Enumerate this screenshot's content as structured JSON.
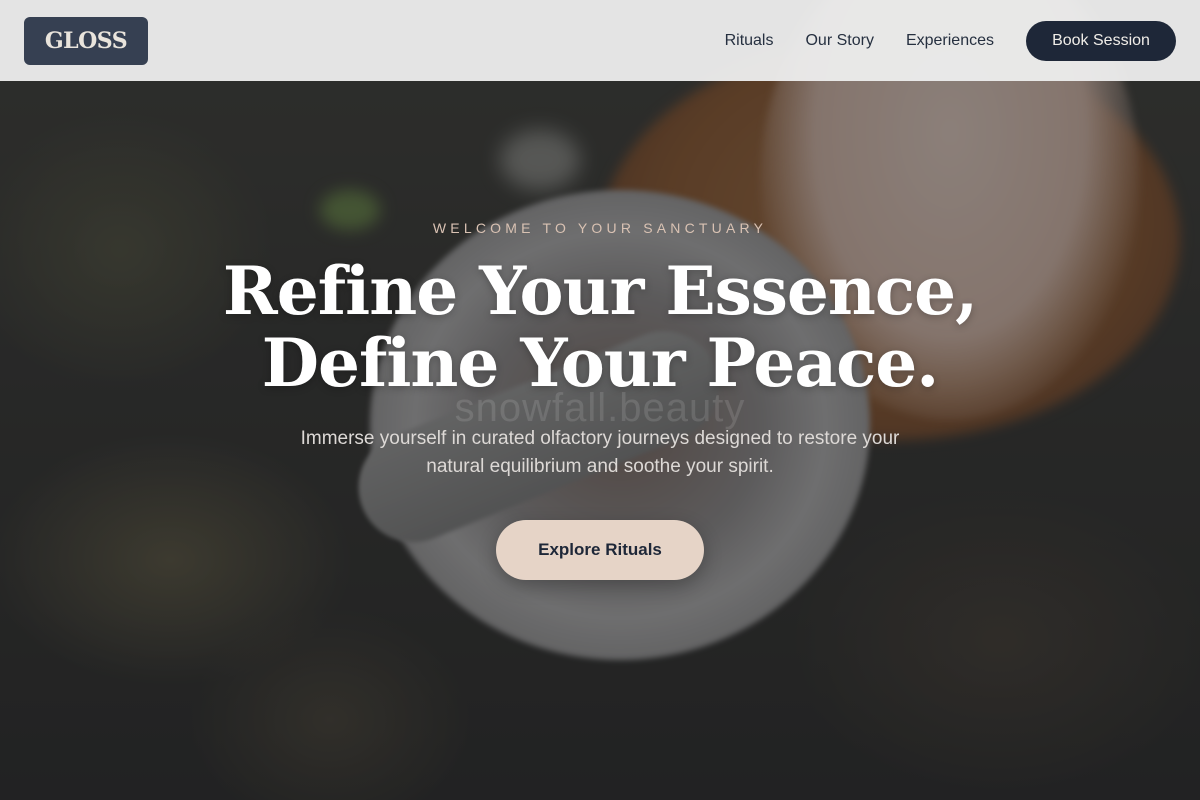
{
  "brand": {
    "logo_text": "GLOSS"
  },
  "nav": {
    "links": [
      {
        "label": "Rituals"
      },
      {
        "label": "Our Story"
      },
      {
        "label": "Experiences"
      }
    ],
    "cta_label": "Book Session"
  },
  "hero": {
    "eyebrow": "WELCOME TO YOUR SANCTUARY",
    "headline_line1": "Refine Your Essence,",
    "headline_line2": "Define Your Peace.",
    "watermark": "snowfall.beauty",
    "subtitle": "Immerse yourself in curated olfactory journeys designed to restore your natural equilibrium and soothe your spirit.",
    "cta_label": "Explore Rituals",
    "background_description_icon": "mortar-and-pestle-photo"
  },
  "colors": {
    "header_bg": "#ececec",
    "logo_bg": "#364052",
    "primary_dark": "#1e2738",
    "accent_blush": "#e6d4c7",
    "eyebrow_text": "#d9c2b3"
  }
}
